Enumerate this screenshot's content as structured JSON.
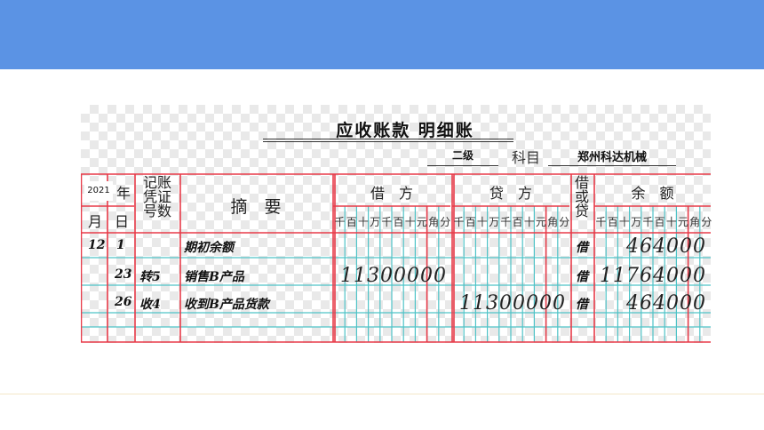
{
  "ledger": {
    "title": "应收账款 明细账",
    "level_label": "二级",
    "subject_label": "科目",
    "subject_value": "郑州科达机械"
  },
  "headers": {
    "year_value": "2021",
    "year_suffix": "年",
    "month": "月",
    "day": "日",
    "voucher": [
      "记账",
      "凭证",
      "号数"
    ],
    "summary": "摘　要",
    "debit": "借　方",
    "credit": "贷　方",
    "dc": [
      "借",
      "或",
      "贷"
    ],
    "balance": "余　额",
    "digit_units": [
      "千",
      "百",
      "十",
      "万",
      "千",
      "百",
      "十",
      "元",
      "角",
      "分"
    ]
  },
  "rows": [
    {
      "month": "12",
      "day": "1",
      "voucher": "",
      "summary": "期初余额",
      "debit": "",
      "credit": "",
      "dc": "借",
      "balance": "464000"
    },
    {
      "month": "",
      "day": "23",
      "voucher": "转5",
      "summary": "销售B产品",
      "debit": "11300000",
      "credit": "",
      "dc": "借",
      "balance": "11764000"
    },
    {
      "month": "",
      "day": "26",
      "voucher": "收4",
      "summary": "收到B产品货款",
      "debit": "",
      "credit": "11300000",
      "dc": "借",
      "balance": "464000"
    }
  ],
  "colors": {
    "banner": "#5b93e4",
    "red_rule": "#e83a48",
    "teal_rule": "#4fc3c7"
  }
}
